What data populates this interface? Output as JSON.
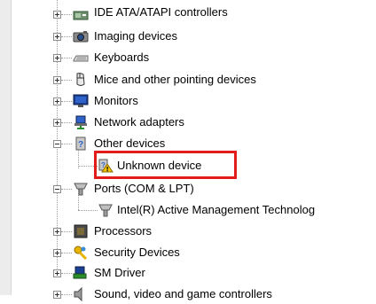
{
  "device_tree": {
    "items": [
      {
        "label": "IDE ATA/ATAPI controllers",
        "state": "collapsed",
        "icon": "ide-controller-icon"
      },
      {
        "label": "Imaging devices",
        "state": "collapsed",
        "icon": "camera-icon"
      },
      {
        "label": "Keyboards",
        "state": "collapsed",
        "icon": "keyboard-icon"
      },
      {
        "label": "Mice and other pointing devices",
        "state": "collapsed",
        "icon": "mouse-icon"
      },
      {
        "label": "Monitors",
        "state": "collapsed",
        "icon": "monitor-icon"
      },
      {
        "label": "Network adapters",
        "state": "collapsed",
        "icon": "network-adapter-icon"
      },
      {
        "label": "Other devices",
        "state": "expanded",
        "icon": "unknown-device-category-icon"
      },
      {
        "label": "Unknown device",
        "state": "leaf",
        "icon": "warning-device-icon",
        "highlighted": true
      },
      {
        "label": "Ports (COM & LPT)",
        "state": "expanded",
        "icon": "port-icon"
      },
      {
        "label": "Intel(R) Active Management Technolog",
        "state": "leaf",
        "icon": "port-icon"
      },
      {
        "label": "Processors",
        "state": "collapsed",
        "icon": "processor-icon"
      },
      {
        "label": "Security Devices",
        "state": "collapsed",
        "icon": "security-key-icon"
      },
      {
        "label": "SM Driver",
        "state": "collapsed",
        "icon": "sm-driver-icon"
      },
      {
        "label": "Sound, video and game controllers",
        "state": "collapsed",
        "icon": "speaker-icon"
      }
    ]
  },
  "colors": {
    "highlight_border": "#e21b1b",
    "warning_yellow": "#f5c400"
  }
}
